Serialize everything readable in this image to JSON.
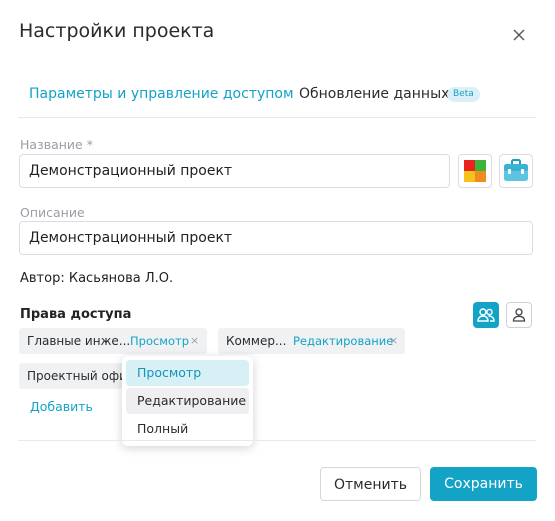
{
  "dialog": {
    "title": "Настройки проекта"
  },
  "tabs": [
    {
      "label": "Параметры и управление доступом"
    },
    {
      "label": "Обновление данных",
      "badge": "Beta"
    }
  ],
  "form": {
    "name_label": "Название *",
    "name_value": "Демонстрационный проект",
    "description_label": "Описание",
    "description_value": "Демонстрационный проект",
    "author": "Автор: Касьянова Л.О."
  },
  "access": {
    "section_label": "Права доступа",
    "chips": [
      {
        "name": "Главные инже...",
        "role": "Просмотр",
        "remove": "×"
      },
      {
        "name": "Коммер...",
        "role": "Редактирование",
        "remove": "×"
      },
      {
        "name": "Проектный офи",
        "role": "",
        "remove": ""
      }
    ],
    "add_label": "Добавить"
  },
  "role_menu": {
    "items": [
      {
        "label": "Просмотр",
        "selected": true
      },
      {
        "label": "Редактирование",
        "hovered": true
      },
      {
        "label": "Полный"
      }
    ]
  },
  "footer": {
    "cancel_label": "Отменить",
    "save_label": "Сохранить"
  },
  "icons": {
    "close": "close-icon",
    "color": "color-palette-icon",
    "project_type": "briefcase-icon",
    "view_groups": "users-group-icon",
    "view_user": "user-icon"
  },
  "colors": {
    "accent": "#13a3c6",
    "chip_bg": "#f0f1f3",
    "palette": [
      "#e8241c",
      "#3cb43c",
      "#f6c21a",
      "#f08c1e"
    ]
  }
}
